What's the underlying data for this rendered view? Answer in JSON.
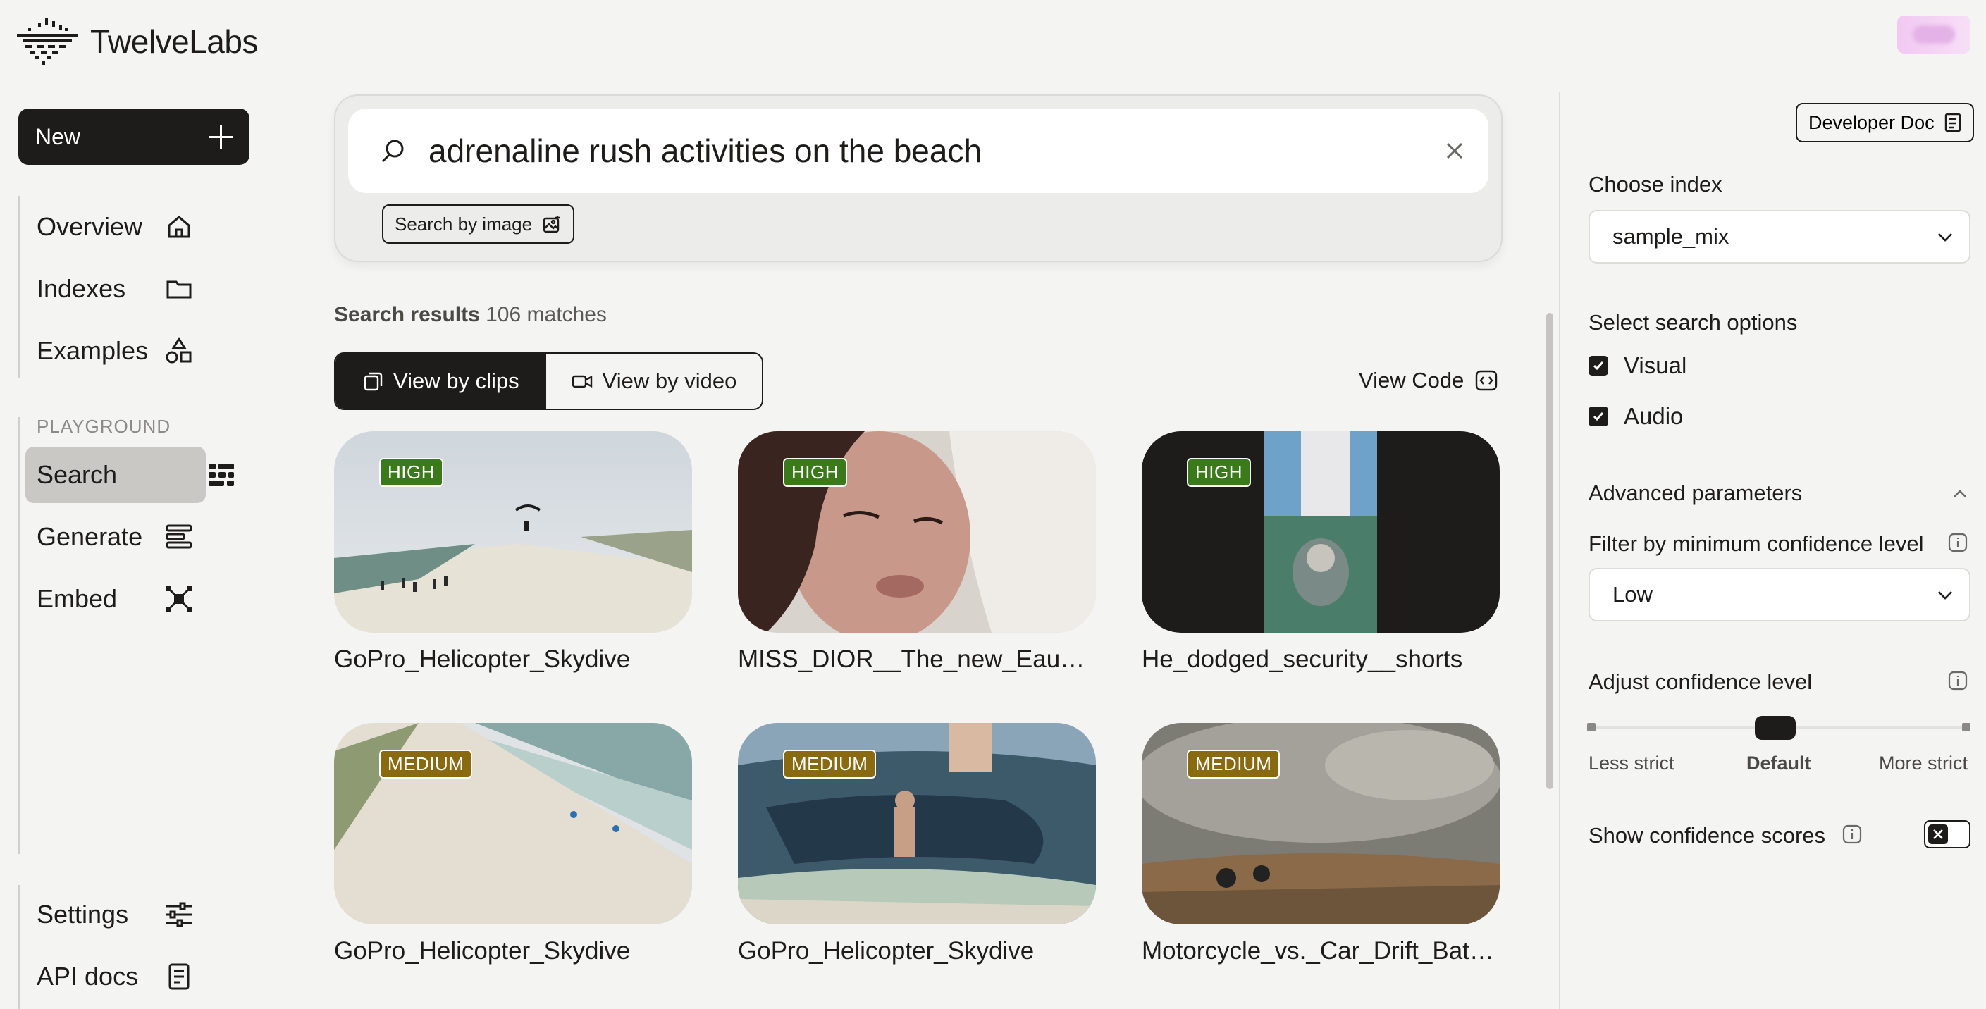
{
  "app": {
    "brand": "TwelveLabs"
  },
  "sidebar": {
    "new_label": "New",
    "nav_primary": [
      {
        "label": "Overview",
        "icon": "home-icon"
      },
      {
        "label": "Indexes",
        "icon": "folder-icon"
      },
      {
        "label": "Examples",
        "icon": "shapes-icon"
      }
    ],
    "section_label": "PLAYGROUND",
    "nav_playground": [
      {
        "label": "Search",
        "icon": "search-grid-icon",
        "active": true
      },
      {
        "label": "Generate",
        "icon": "generate-lines-icon"
      },
      {
        "label": "Embed",
        "icon": "embed-nodes-icon"
      }
    ],
    "nav_bottom": [
      {
        "label": "Settings",
        "icon": "sliders-icon"
      },
      {
        "label": "API docs",
        "icon": "document-icon"
      }
    ]
  },
  "search": {
    "query": "adrenaline rush activities on the beach",
    "image_search_label": "Search by image"
  },
  "results": {
    "title": "Search results",
    "count": "106 matches",
    "view_clips": "View by clips",
    "view_video": "View by video",
    "view_code": "View Code",
    "items": [
      {
        "title": "GoPro_Helicopter_Skydive",
        "confidence": "HIGH"
      },
      {
        "title": "MISS_DIOR__The_new_Eau_de_Parfum",
        "confidence": "HIGH"
      },
      {
        "title": "He_dodged_security__shorts",
        "confidence": "HIGH"
      },
      {
        "title": "GoPro_Helicopter_Skydive",
        "confidence": "MEDIUM"
      },
      {
        "title": "GoPro_Helicopter_Skydive",
        "confidence": "MEDIUM"
      },
      {
        "title": "Motorcycle_vs._Car_Drift_Battle_Tokyo",
        "confidence": "MEDIUM"
      }
    ]
  },
  "panel": {
    "developer_doc": "Developer Doc",
    "choose_index_label": "Choose index",
    "index_value": "sample_mix",
    "search_options_label": "Select search options",
    "options": [
      {
        "label": "Visual",
        "checked": true
      },
      {
        "label": "Audio",
        "checked": true
      }
    ],
    "advanced_label": "Advanced parameters",
    "filter_label": "Filter by minimum confidence level",
    "filter_value": "Low",
    "adjust_label": "Adjust confidence level",
    "slider": {
      "left": "Less strict",
      "middle": "Default",
      "right": "More strict",
      "value": 0.5
    },
    "show_scores_label": "Show confidence scores",
    "show_scores_on": false
  },
  "colors": {
    "accent_dark": "#1d1c1b",
    "high_badge": "#3a7a1a",
    "medium_badge": "#8a6a10"
  }
}
